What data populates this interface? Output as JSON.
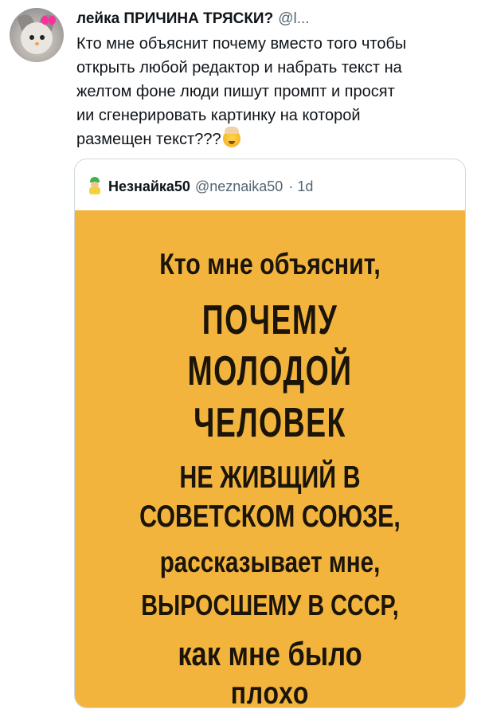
{
  "tweet": {
    "author": {
      "display_name": "лейка ПРИЧИНА ТРЯСКИ?",
      "handle": "@l..."
    },
    "text_lines": [
      "Кто мне объяснит почему вместо того чтобы",
      "открыть любой редактор и набрать текст на",
      "желтом фоне люди пишут промпт и просят",
      "ии сгенерировать картинку на которой",
      "размещен текст???"
    ],
    "emoji": "exploding-head-emoji"
  },
  "quote": {
    "author": {
      "display_name": "Незнайка50",
      "handle": "@neznaika50",
      "time": "· 1d"
    },
    "poster": {
      "background": "#f2b43d",
      "lines": [
        "Кто мне объяснит,",
        "ПОЧЕМУ",
        "МОЛОДОЙ",
        "ЧЕЛОВЕК",
        "НЕ ЖИВЩИЙ В",
        "СОВЕТСКОМ СОЮЗЕ,",
        "рассказывает мне,",
        "ВЫРОСШЕМУ В СССР,",
        "как мне  было",
        "плохо"
      ]
    }
  }
}
